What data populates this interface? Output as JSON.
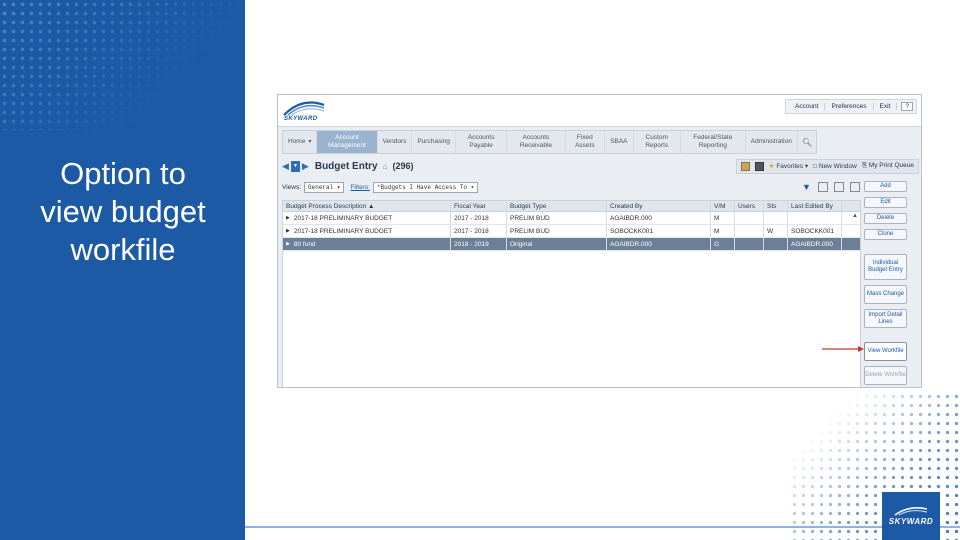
{
  "slide": {
    "title_lines": [
      "Option to",
      "view budget",
      "workfile"
    ],
    "logo_text": "SKYWARD",
    "colors": {
      "panel_blue": "#1d5aa6",
      "selected_row": "#6d7f96",
      "arrow_red": "#c0392b"
    }
  },
  "app": {
    "logo_text": "SKYWARD",
    "top_links": [
      "Account",
      "Preferences",
      "Exit",
      "?"
    ],
    "menu": [
      {
        "label": "Home",
        "caret": "▾"
      },
      {
        "label": "Account Management",
        "active": true
      },
      {
        "label": "Vendors"
      },
      {
        "label": "Purchasing"
      },
      {
        "label": "Accounts Payable"
      },
      {
        "label": "Accounts Receivable"
      },
      {
        "label": "Fixed Assets"
      },
      {
        "label": "SBAA"
      },
      {
        "label": "Custom Reports"
      },
      {
        "label": "Federal/State Reporting"
      },
      {
        "label": "Administration"
      }
    ],
    "menu_search_icon": "search-icon",
    "page_title": "Budget Entry",
    "count": "(296)",
    "title_tools": {
      "favorites": "Favorites ▾",
      "new_window": "New Window",
      "print_queue": "My Print Queue"
    },
    "filters": {
      "views_label": "Views:",
      "views_value": "General ▾",
      "filters_label": "Filters:",
      "filters_value": "*Budgets I Have Access To ▾"
    },
    "grid": {
      "headers": [
        "Budget Process Description ▲",
        "Fiscal Year",
        "Budget Type",
        "Created By",
        "V/M",
        "Users",
        "Sts",
        "Last Edited By"
      ],
      "rows": [
        [
          "2017-18 PRELIMINARY BUDGET",
          "2017 - 2018",
          "PRELIM BUD",
          "AGAIBDR.000",
          "M",
          "",
          "",
          ""
        ],
        [
          "2017-18 PRELIMINARY BUDGET",
          "2017 - 2018",
          "PRELIM BUD",
          "SOBOCKK001",
          "M",
          "",
          "W",
          "SOBOCKK001"
        ],
        [
          "80 fund",
          "2018 - 2019",
          "Original",
          "AGAIBDR.000",
          "G",
          "",
          "",
          "AGAIBDR.000"
        ]
      ],
      "selected_row": 2
    },
    "side_buttons": [
      {
        "label": "Add"
      },
      {
        "label": "Edit"
      },
      {
        "label": "Delete"
      },
      {
        "label": "Clone"
      },
      {
        "label": "Individual Budget Entry"
      },
      {
        "label": "Mass Change"
      },
      {
        "label": "Import Detail Lines"
      },
      {
        "label": "View Workfile",
        "highlight": true
      },
      {
        "label": "Delete Workfile",
        "dim": true
      }
    ]
  }
}
